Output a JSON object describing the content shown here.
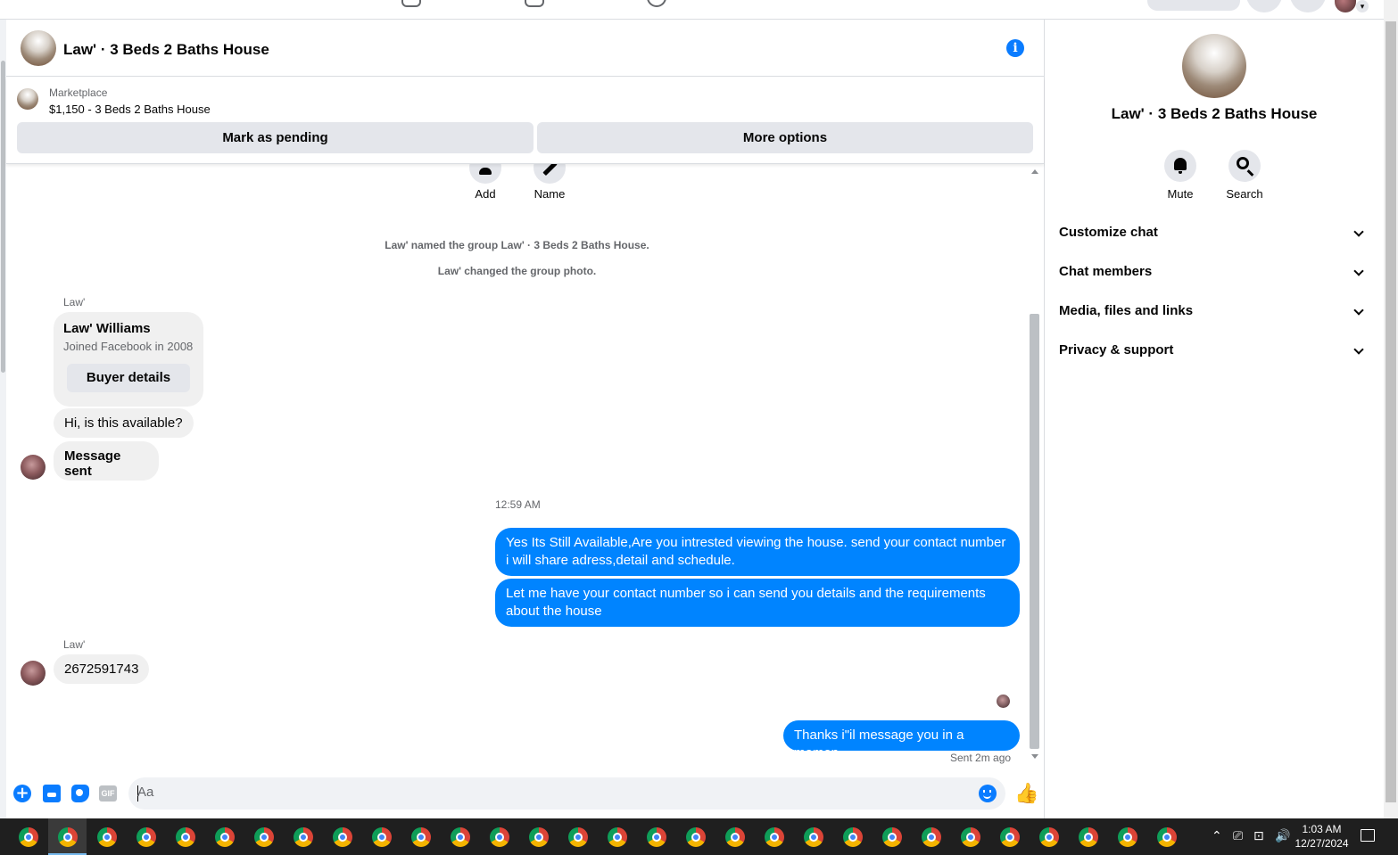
{
  "chat": {
    "title": "Law' · 3 Beds 2 Baths House",
    "marketplace_label": "Marketplace",
    "listing": "$1,150 - 3 Beds 2 Baths House",
    "mark_pending_label": "Mark as pending",
    "more_options_label": "More options"
  },
  "actions": {
    "add_label": "Add",
    "name_label": "Name"
  },
  "system_messages": [
    "Law' named the group Law' · 3 Beds 2 Baths House.",
    "Law' changed the group photo."
  ],
  "buyer_card": {
    "sender": "Law'",
    "name": "Law' Williams",
    "joined": "Joined Facebook in 2008",
    "button": "Buyer details"
  },
  "messages_in_1": [
    "Hi, is this available?",
    "Message sent"
  ],
  "timestamp": "12:59 AM",
  "messages_out": [
    "Yes Its Still Available,Are you intrested viewing the house. send your contact number i will share adress,detail and schedule.",
    "Let me have your contact number so i can send you details and the requirements about the house"
  ],
  "second_sender": "Law'",
  "messages_in_2": [
    "2672591743"
  ],
  "last_out": "Thanks i\"il message you in a momen",
  "sent_status": "Sent 2m ago",
  "composer": {
    "placeholder": "Aa",
    "gif_label": "GIF"
  },
  "right_panel": {
    "title": "Law' · 3 Beds 2 Baths House",
    "mute_label": "Mute",
    "search_label": "Search",
    "sections": [
      "Customize chat",
      "Chat members",
      "Media, files and links",
      "Privacy & support"
    ]
  },
  "taskbar": {
    "time": "1:03 AM",
    "date": "12/27/2024"
  },
  "colors": {
    "accent": "#0084ff",
    "bubble_in": "#f0f0f0",
    "taskbar": "#1f1f1f"
  }
}
